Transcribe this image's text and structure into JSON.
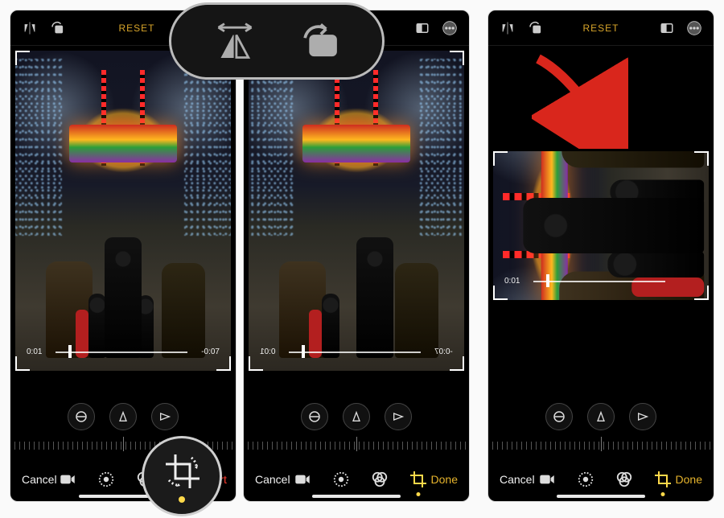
{
  "topbar": {
    "reset_label": "RESET",
    "icons": {
      "flip": "flip-icon",
      "rotate": "rotate-icon",
      "aspect": "aspect-icon",
      "more": "more-icon"
    }
  },
  "video": {
    "elapsed": "0:01",
    "remaining": "-0:07"
  },
  "bottombar": {
    "cancel": "Cancel",
    "done": "Done",
    "revert": "Revert"
  },
  "adjusters": [
    "straighten",
    "vertical-perspective",
    "horizontal-perspective"
  ],
  "tools": [
    "video-tab",
    "adjust-tab",
    "filters-tab",
    "crop-tab"
  ],
  "callout_icons": [
    "flip-horizontal-icon",
    "rotate-ccw-icon"
  ]
}
